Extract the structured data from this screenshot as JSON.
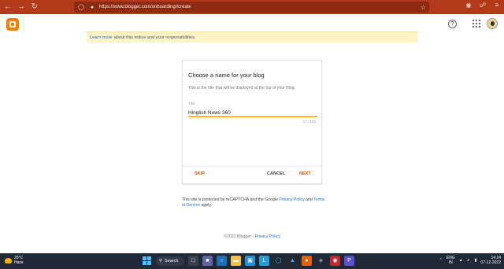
{
  "browser": {
    "url": "https://www.blogger.com/onboarding#create",
    "back_icon": "arrow-left",
    "forward_icon": "arrow-right",
    "reload_icon": "reload"
  },
  "app": {
    "brand_color": "#f57d00",
    "help_icon": "?"
  },
  "notice": {
    "link_text": "Learn more",
    "text": "about this notice and your responsibilities."
  },
  "dialog": {
    "title": "Choose a name for your blog",
    "subtitle": "This is the title that will be displayed at the top of your Blog.",
    "field_label": "Title",
    "field_value": "Hinglish News 360",
    "char_count": "17 / 100",
    "skip_label": "SKIP",
    "cancel_label": "CANCEL",
    "next_label": "NEXT"
  },
  "recaptcha": {
    "text_before": "This site is protected by reCAPTCHA and the Google ",
    "privacy_link": "Privacy Policy",
    "and": " and ",
    "terms_link": "Terms of Service",
    "text_after": " apply."
  },
  "footer": {
    "copyright": "©2022 Blogger - ",
    "privacy_link": "Privacy Policy"
  },
  "taskbar": {
    "temperature": "25°C",
    "weather": "Haze",
    "search_label": "Search",
    "lang_line1": "ENG",
    "lang_line2": "IN",
    "time": "14:24",
    "date": "07-12-2022"
  }
}
